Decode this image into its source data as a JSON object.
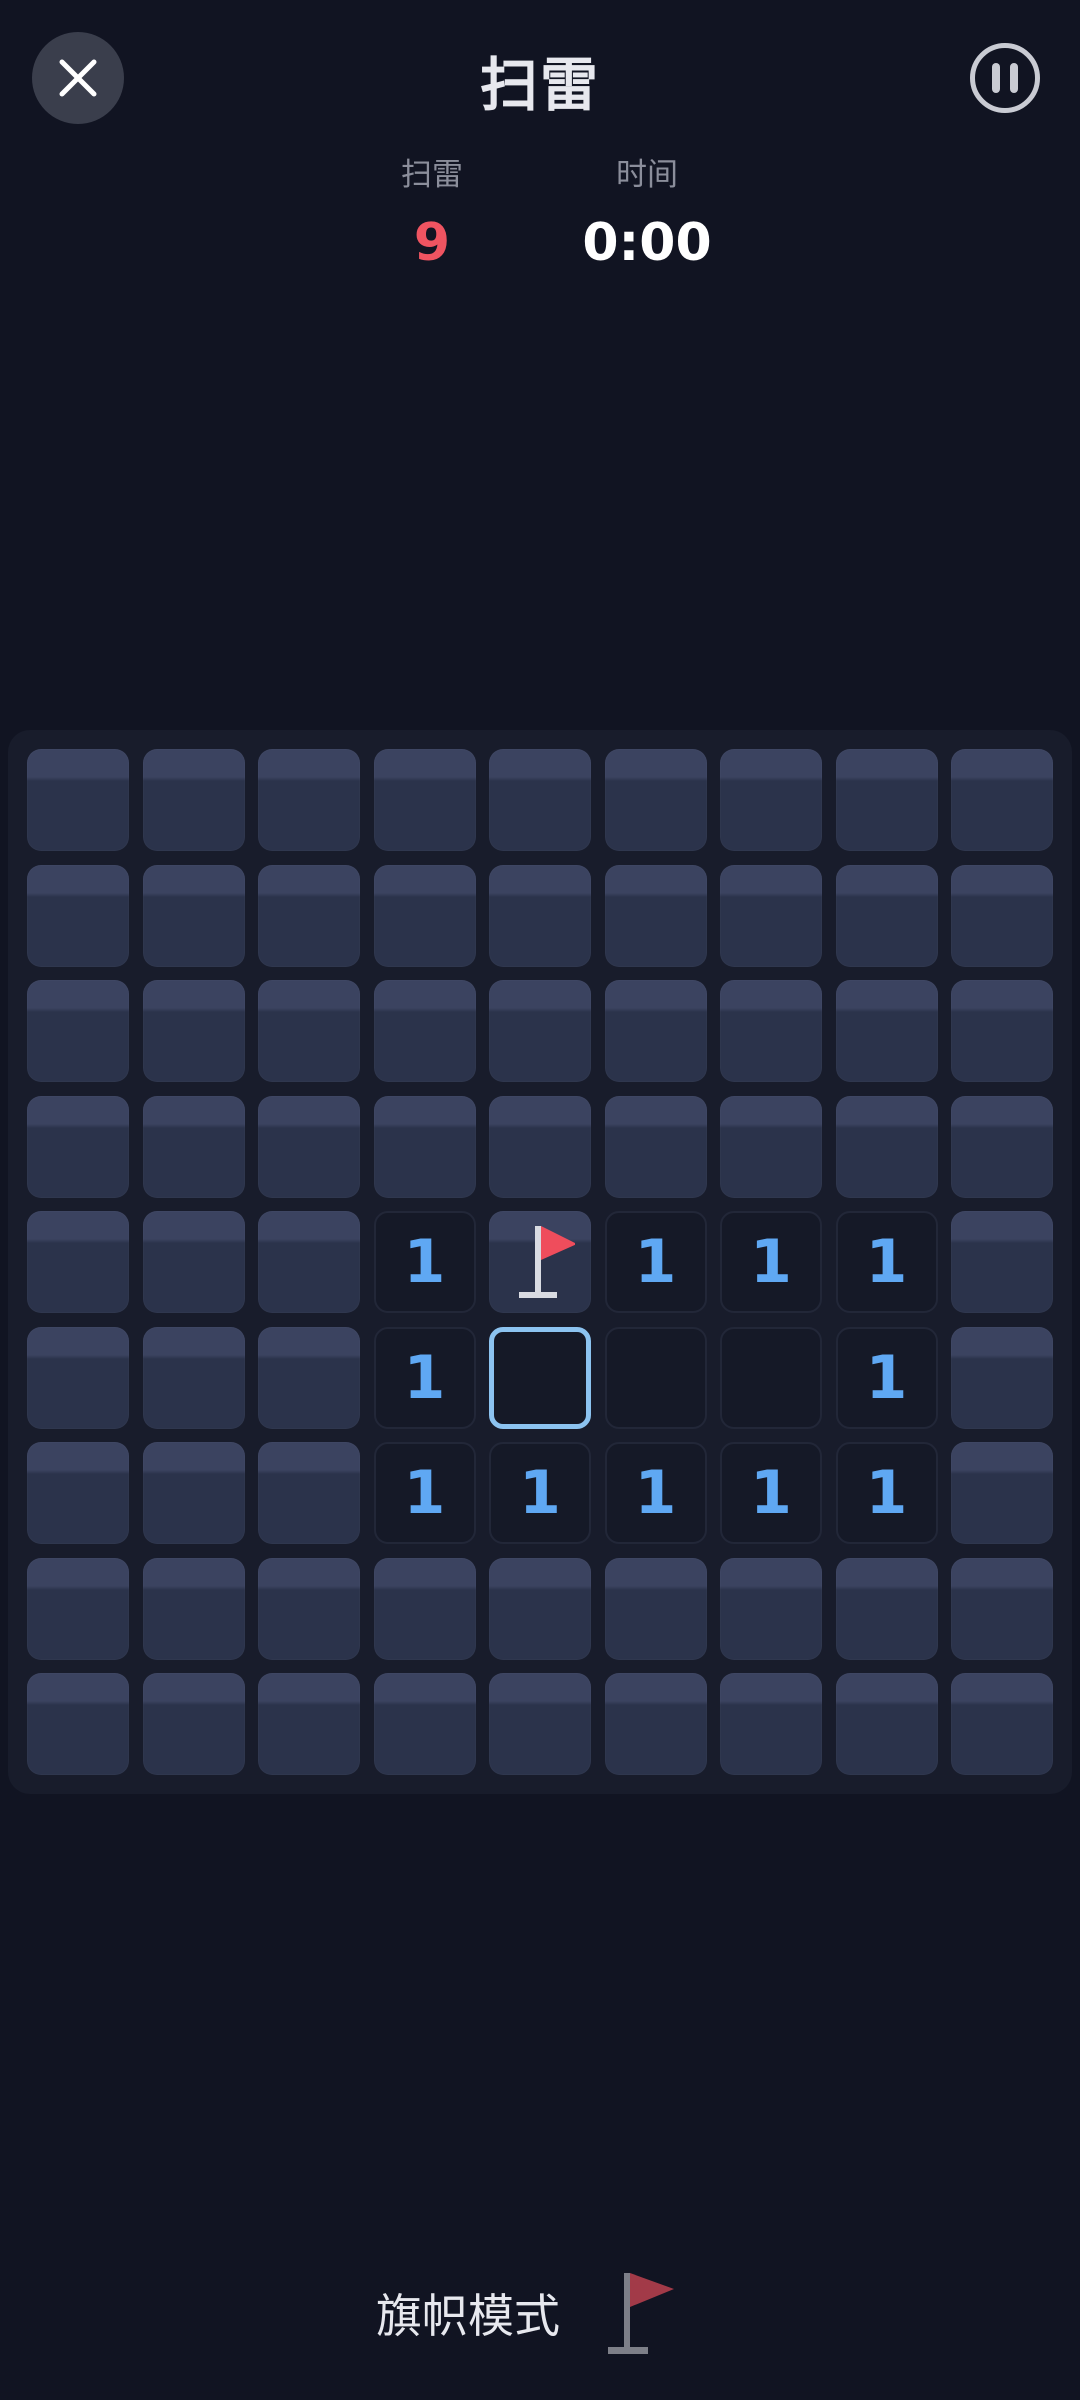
{
  "header": {
    "title": "扫雷",
    "close_icon": "close-icon",
    "pause_icon": "pause-icon"
  },
  "stats": {
    "mines_label": "扫雷",
    "mines_value": "9",
    "time_label": "时间",
    "time_value": "0:00"
  },
  "board": {
    "rows": 9,
    "cols": 9,
    "cells": [
      [
        "covered",
        "covered",
        "covered",
        "covered",
        "covered",
        "covered",
        "covered",
        "covered",
        "covered"
      ],
      [
        "covered",
        "covered",
        "covered",
        "covered",
        "covered",
        "covered",
        "covered",
        "covered",
        "covered"
      ],
      [
        "covered",
        "covered",
        "covered",
        "covered",
        "covered",
        "covered",
        "covered",
        "covered",
        "covered"
      ],
      [
        "covered",
        "covered",
        "covered",
        "covered",
        "covered",
        "covered",
        "covered",
        "covered",
        "covered"
      ],
      [
        "covered",
        "covered",
        "covered",
        "1",
        "flag",
        "1",
        "1",
        "1",
        "covered"
      ],
      [
        "covered",
        "covered",
        "covered",
        "1",
        "selected",
        "empty",
        "empty",
        "1",
        "covered"
      ],
      [
        "covered",
        "covered",
        "covered",
        "1",
        "1",
        "1",
        "1",
        "1",
        "covered"
      ],
      [
        "covered",
        "covered",
        "covered",
        "covered",
        "covered",
        "covered",
        "covered",
        "covered",
        "covered"
      ],
      [
        "covered",
        "covered",
        "covered",
        "covered",
        "covered",
        "covered",
        "covered",
        "covered",
        "covered"
      ]
    ]
  },
  "footer": {
    "flag_mode_label": "旗帜模式",
    "flag_icon": "flag-icon"
  },
  "colors": {
    "background": "#111422",
    "mine_count": "#ef5461",
    "number": "#5fa8f3",
    "flag": "#ef4d5c",
    "selected_border": "#8cc3f0"
  }
}
